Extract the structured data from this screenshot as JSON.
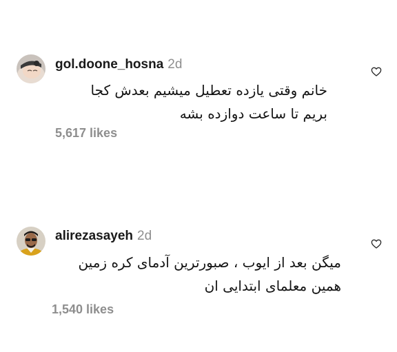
{
  "comments": [
    {
      "username": "gol.doone_hosna",
      "time": "2d",
      "lines": [
        "خانم وقتی یازده تعطیل میشیم بعدش کجا",
        "بریم تا ساعت دوازده بشه"
      ],
      "likes": "5,617 likes",
      "like_icon": "heart-outline-icon"
    },
    {
      "username": "alirezasayeh",
      "time": "2d",
      "lines": [
        "میگن بعد از ایوب ، صبورترین آدمای کره زمین",
        "همین معلمای ابتدایی ان"
      ],
      "likes": "1,540 likes",
      "like_icon": "heart-outline-icon"
    }
  ],
  "colors": {
    "text": "#141414",
    "muted": "#8e8e8e",
    "background": "#ffffff"
  }
}
